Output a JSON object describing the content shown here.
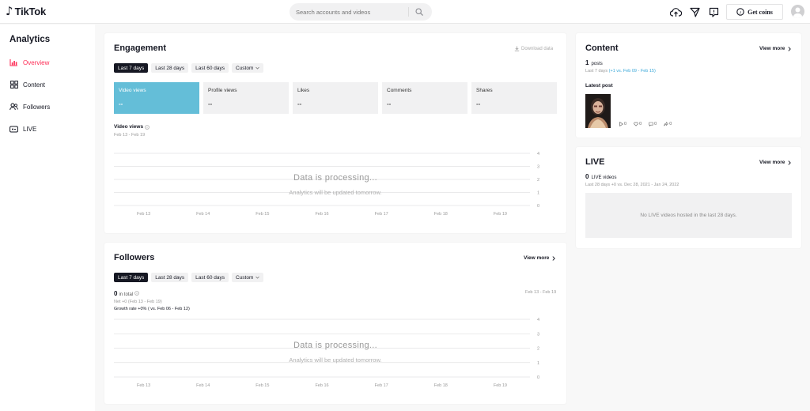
{
  "header": {
    "logo_mark": "♪",
    "logo_text": "TikTok",
    "search_placeholder": "Search accounts and videos",
    "get_coins_label": "Get coins"
  },
  "sidebar": {
    "title": "Analytics",
    "items": [
      {
        "label": "Overview",
        "icon": "chart-icon",
        "active": true
      },
      {
        "label": "Content",
        "icon": "grid-icon",
        "active": false
      },
      {
        "label": "Followers",
        "icon": "people-icon",
        "active": false
      },
      {
        "label": "LIVE",
        "icon": "live-icon",
        "active": false
      }
    ]
  },
  "engagement": {
    "title": "Engagement",
    "download_label": "Download data",
    "ranges": [
      "Last 7 days",
      "Last 28 days",
      "Last 60 days",
      "Custom"
    ],
    "metrics": [
      {
        "label": "Video views",
        "value": "--"
      },
      {
        "label": "Profile views",
        "value": "--"
      },
      {
        "label": "Likes",
        "value": "--"
      },
      {
        "label": "Comments",
        "value": "--"
      },
      {
        "label": "Shares",
        "value": "--"
      }
    ],
    "chart_title": "Video views",
    "chart_range": "Feb 13 - Feb 19",
    "processing_title": "Data is processing...",
    "processing_sub": "Analytics will be updated tomorrow."
  },
  "followers": {
    "title": "Followers",
    "view_more": "View more",
    "ranges": [
      "Last 7 days",
      "Last 28 days",
      "Last 60 days",
      "Custom"
    ],
    "total_value": "0",
    "total_label": "in total",
    "net_line": "Net +0 (Feb 13 - Feb 19)",
    "growth_line": "Growth rate +0% ( vs. Feb 06 - Feb 12)",
    "date_range": "Feb 13 - Feb 19",
    "processing_title": "Data is processing...",
    "processing_sub": "Analytics will be updated tomorrow."
  },
  "content": {
    "title": "Content",
    "view_more": "View more",
    "posts_value": "1",
    "posts_label": "posts",
    "compare_prefix": "Last 7 days ",
    "compare_highlight": "(+1 vs. Feb 09 - Feb 15)",
    "latest_label": "Latest post",
    "stats": {
      "views": "0",
      "likes": "0",
      "comments": "0",
      "shares": "0"
    }
  },
  "live": {
    "title": "LIVE",
    "view_more": "View more",
    "videos_value": "0",
    "videos_label": "LIVE videos",
    "compare_line": "Last 28 days +0 vs. Dec 28, 2021 - Jan 24, 2022",
    "empty_text": "No LIVE videos hosted in the last 28 days."
  },
  "chart_data": [
    {
      "type": "line",
      "title": "Video views",
      "categories": [
        "Feb 13",
        "Feb 14",
        "Feb 15",
        "Feb 16",
        "Feb 17",
        "Feb 18",
        "Feb 19"
      ],
      "yticks": [
        0,
        1,
        2,
        3,
        4
      ],
      "ylim": [
        0,
        4
      ],
      "series": [],
      "grid": true
    },
    {
      "type": "line",
      "categories": [
        "Feb 13",
        "Feb 14",
        "Feb 15",
        "Feb 16",
        "Feb 17",
        "Feb 18",
        "Feb 19"
      ],
      "yticks": [
        0,
        1,
        2,
        3,
        4
      ],
      "ylim": [
        0,
        4
      ],
      "series": [],
      "grid": true
    }
  ],
  "colors": {
    "accent": "#fe2c55",
    "active_metric": "#64bed8",
    "link_blue": "#3aa8d8"
  }
}
